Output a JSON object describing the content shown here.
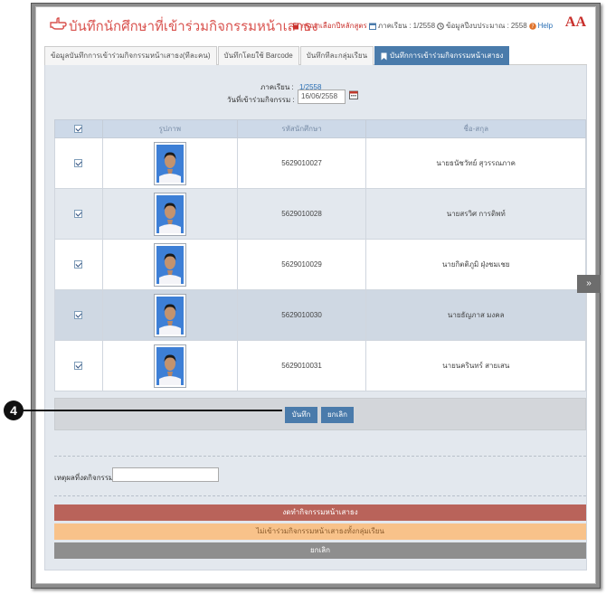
{
  "header": {
    "title": "บันทึกนักศึกษาที่เข้าร่วมกิจกรรมหน้าเสาธง",
    "curriculum_hint": "กรุณาเลือกปีหลักสูตร",
    "semester_label": "ภาคเรียน :",
    "semester_value": "1/2558",
    "budget_label": "ข้อมูลปีงบประมาณ :",
    "budget_value": "2558",
    "help_label": "Help",
    "font_size_label": "AA"
  },
  "tabs": [
    {
      "label": "ข้อมูลบันทึกการเข้าร่วมกิจกรรมหน้าเสาธง(ทีละคน)"
    },
    {
      "label": "บันทึกโดยใช้ Barcode"
    },
    {
      "label": "บันทึกทีละกลุ่มเรียน"
    },
    {
      "label": "บันทึกการเข้าร่วมกิจกรรมหน้าเสาธง",
      "active": true
    }
  ],
  "form": {
    "semester_label": "ภาคเรียน :",
    "semester_value": "1/2558",
    "date_label": "วันที่เข้าร่วมกิจกรรม :",
    "date_value": "16/06/2558"
  },
  "table": {
    "columns": [
      "รูปภาพ",
      "รหัสนักศึกษา",
      "ชื่อ-สกุล"
    ],
    "rows": [
      {
        "id": "5629010027",
        "name": "นายธนัชวัทย์ สุวรรณภาค",
        "checked": true
      },
      {
        "id": "5629010028",
        "name": "นายสรวิศ การดิพท์",
        "checked": true
      },
      {
        "id": "5629010029",
        "name": "นายกิตติภูมิ ฝุ่งชมเชย",
        "checked": true
      },
      {
        "id": "5629010030",
        "name": "นายธัญภาส มงคล",
        "checked": true
      },
      {
        "id": "5629010031",
        "name": "นายนครินทร์ สายเสน",
        "checked": true
      }
    ]
  },
  "buttons": {
    "save": "บันทึก",
    "cancel": "ยกเลิก"
  },
  "reason": {
    "label": "เหตุผลที่งดกิจกรรม"
  },
  "actions": {
    "suspend": "งดทำกิจกรรมหน้าเสาธง",
    "absent_all": "ไม่เข้าร่วมกิจกรรมหน้าเสาธงทั้งกลุ่มเรียน",
    "cancel": "ยกเลิก"
  },
  "scroll_top_icon": "double-chevron-up-icon",
  "callout": {
    "number": "4"
  },
  "colors": {
    "accent": "#4a7bab",
    "title": "#d9534f",
    "suspend": "#b9635a",
    "absent": "#f8c28a",
    "cancel": "#8e8e8e"
  }
}
